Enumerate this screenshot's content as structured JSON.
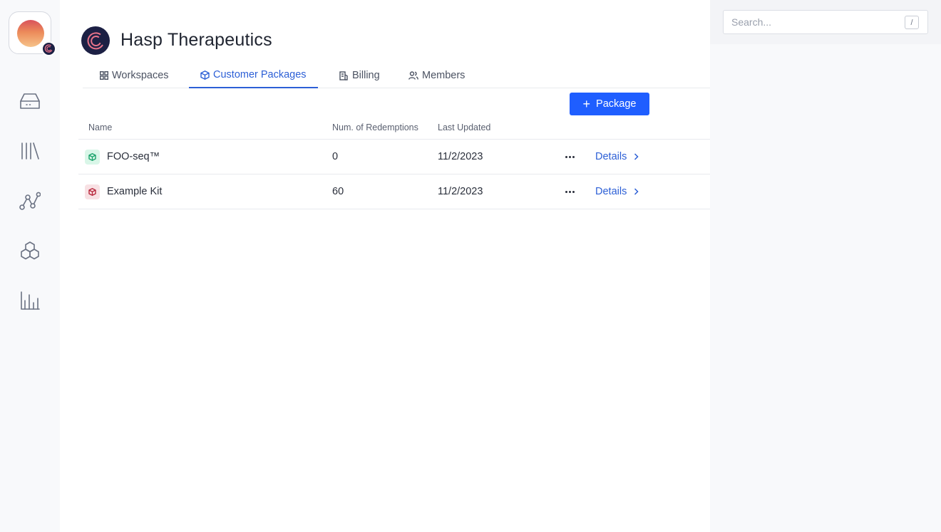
{
  "org": {
    "name": "Hasp Therapeutics"
  },
  "tabs": [
    {
      "label": "Workspaces",
      "icon": "grid-icon",
      "active": false
    },
    {
      "label": "Customer Packages",
      "icon": "package-icon",
      "active": true
    },
    {
      "label": "Billing",
      "icon": "billing-icon",
      "active": false
    },
    {
      "label": "Members",
      "icon": "members-icon",
      "active": false
    }
  ],
  "actions": {
    "add_package_label": "Package"
  },
  "table": {
    "columns": [
      "Name",
      "Num. of Redemptions",
      "Last Updated"
    ],
    "rows": [
      {
        "name": "FOO-seq™",
        "redemptions": "0",
        "last_updated": "11/2/2023",
        "details_label": "Details",
        "icon_color": "#1aa36b",
        "icon_bg": "#d9f6e8"
      },
      {
        "name": "Example Kit",
        "redemptions": "60",
        "last_updated": "11/2/2023",
        "details_label": "Details",
        "icon_color": "#b8283d",
        "icon_bg": "#f8e1e4"
      }
    ]
  },
  "search": {
    "placeholder": "Search...",
    "shortcut": "/"
  },
  "colors": {
    "accent": "#1f5eff",
    "link": "#2c5fd6"
  }
}
